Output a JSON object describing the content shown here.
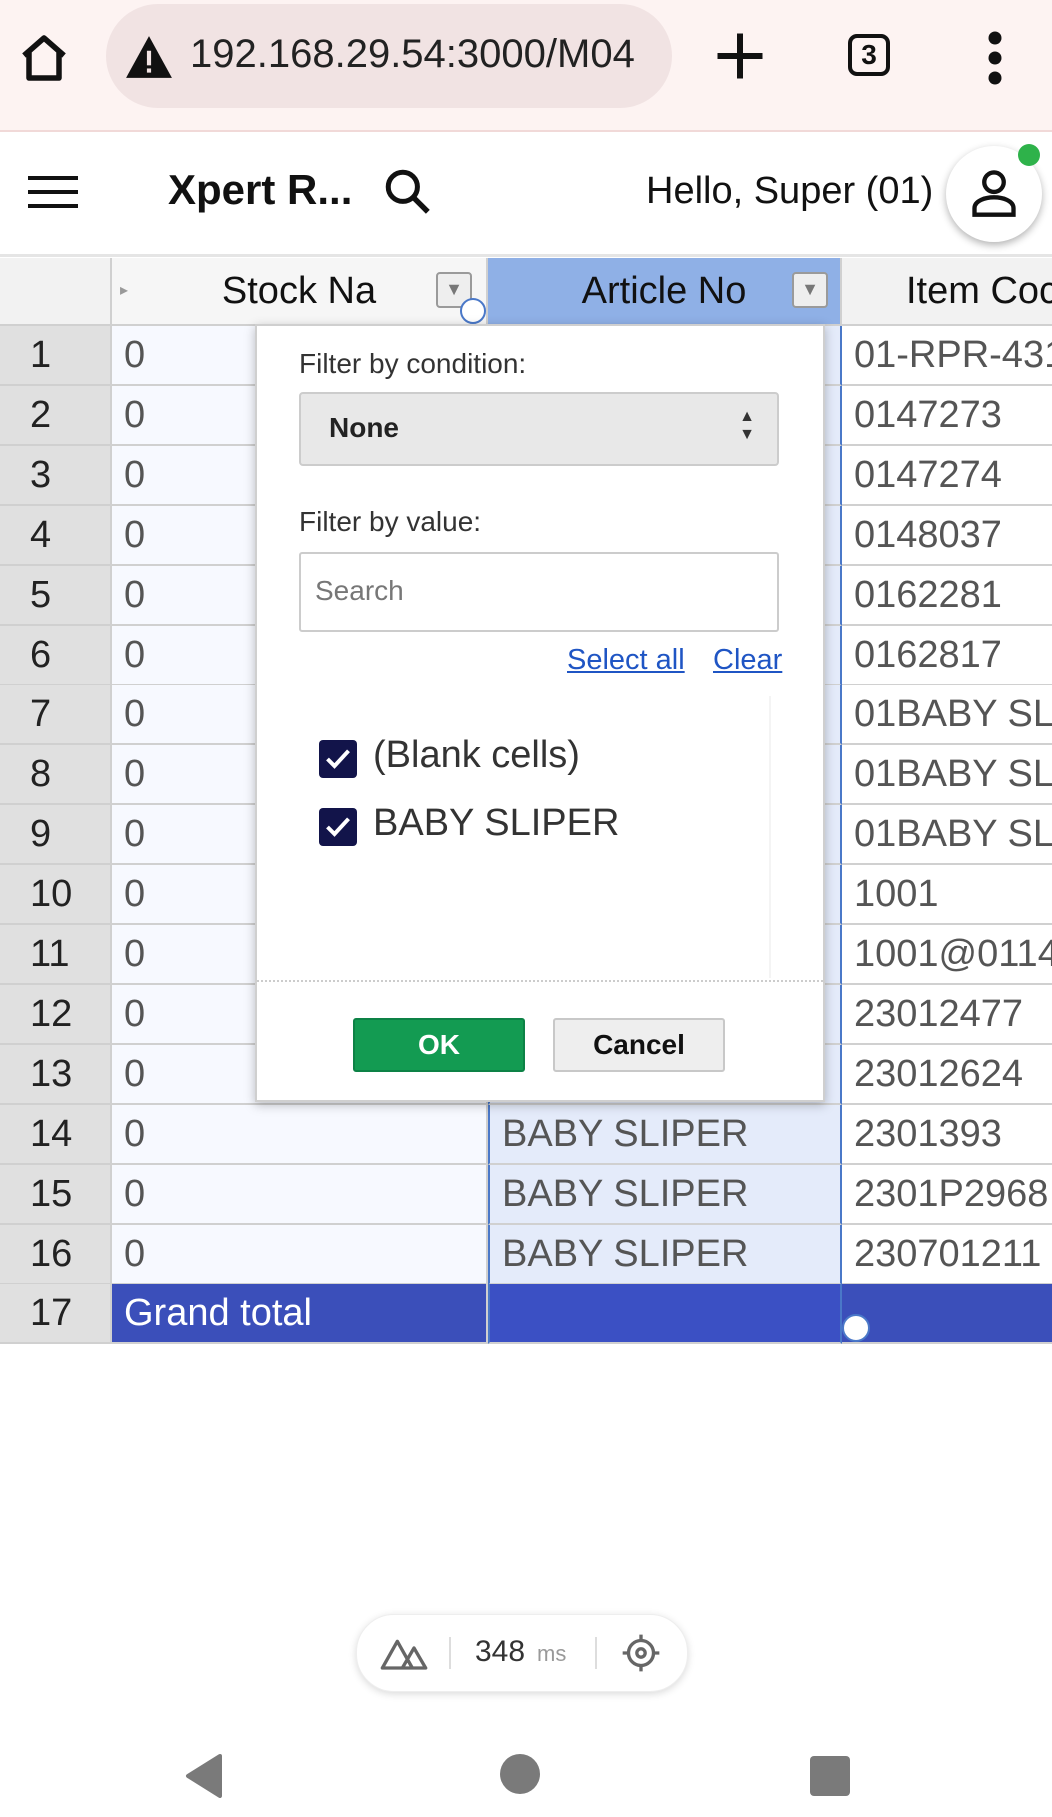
{
  "browser": {
    "url": "192.168.29.54:3000/M04",
    "tab_count": "3"
  },
  "app": {
    "title": "Xpert R...",
    "greeting": "Hello, Super (01)"
  },
  "grid": {
    "columns": [
      "Stock Na",
      "Article No",
      "Item Coc"
    ],
    "rows": [
      {
        "n": "1",
        "stock": "0",
        "article": "",
        "item": "01-RPR-431"
      },
      {
        "n": "2",
        "stock": "0",
        "article": "",
        "item": "0147273"
      },
      {
        "n": "3",
        "stock": "0",
        "article": "",
        "item": "0147274"
      },
      {
        "n": "4",
        "stock": "0",
        "article": "",
        "item": "0148037"
      },
      {
        "n": "5",
        "stock": "0",
        "article": "",
        "item": "0162281"
      },
      {
        "n": "6",
        "stock": "0",
        "article": "",
        "item": "0162817"
      },
      {
        "n": "7",
        "stock": "0",
        "article": "",
        "item": "01BABY SL"
      },
      {
        "n": "8",
        "stock": "0",
        "article": "",
        "item": "01BABY SL"
      },
      {
        "n": "9",
        "stock": "0",
        "article": "",
        "item": "01BABY SL"
      },
      {
        "n": "10",
        "stock": "0",
        "article": "",
        "item": "1001"
      },
      {
        "n": "11",
        "stock": "0",
        "article": "",
        "item": "1001@0114"
      },
      {
        "n": "12",
        "stock": "0",
        "article": "",
        "item": "23012477"
      },
      {
        "n": "13",
        "stock": "0",
        "article": "",
        "item": "23012624"
      },
      {
        "n": "14",
        "stock": "0",
        "article": "BABY SLIPER",
        "item": "2301393"
      },
      {
        "n": "15",
        "stock": "0",
        "article": "BABY SLIPER",
        "item": "2301P2968"
      },
      {
        "n": "16",
        "stock": "0",
        "article": "BABY SLIPER",
        "item": "230701211"
      }
    ],
    "grand_total": {
      "n": "17",
      "label": "Grand total"
    }
  },
  "filter_menu": {
    "condition_label": "Filter by condition:",
    "condition_value": "None",
    "value_label": "Filter by value:",
    "search_placeholder": "Search",
    "select_all": "Select all",
    "clear": "Clear",
    "values": [
      {
        "label": "(Blank cells)",
        "checked": true
      },
      {
        "label": "BABY SLIPER",
        "checked": true
      }
    ],
    "ok": "OK",
    "cancel": "Cancel"
  },
  "dev_tools": {
    "ms_value": "348",
    "ms_unit": "ms"
  },
  "colors": {
    "header_selected": "#8fb0e6",
    "grand_total_bg": "#3b4fba",
    "ok_button": "#139b52",
    "link": "#1f55c4"
  }
}
